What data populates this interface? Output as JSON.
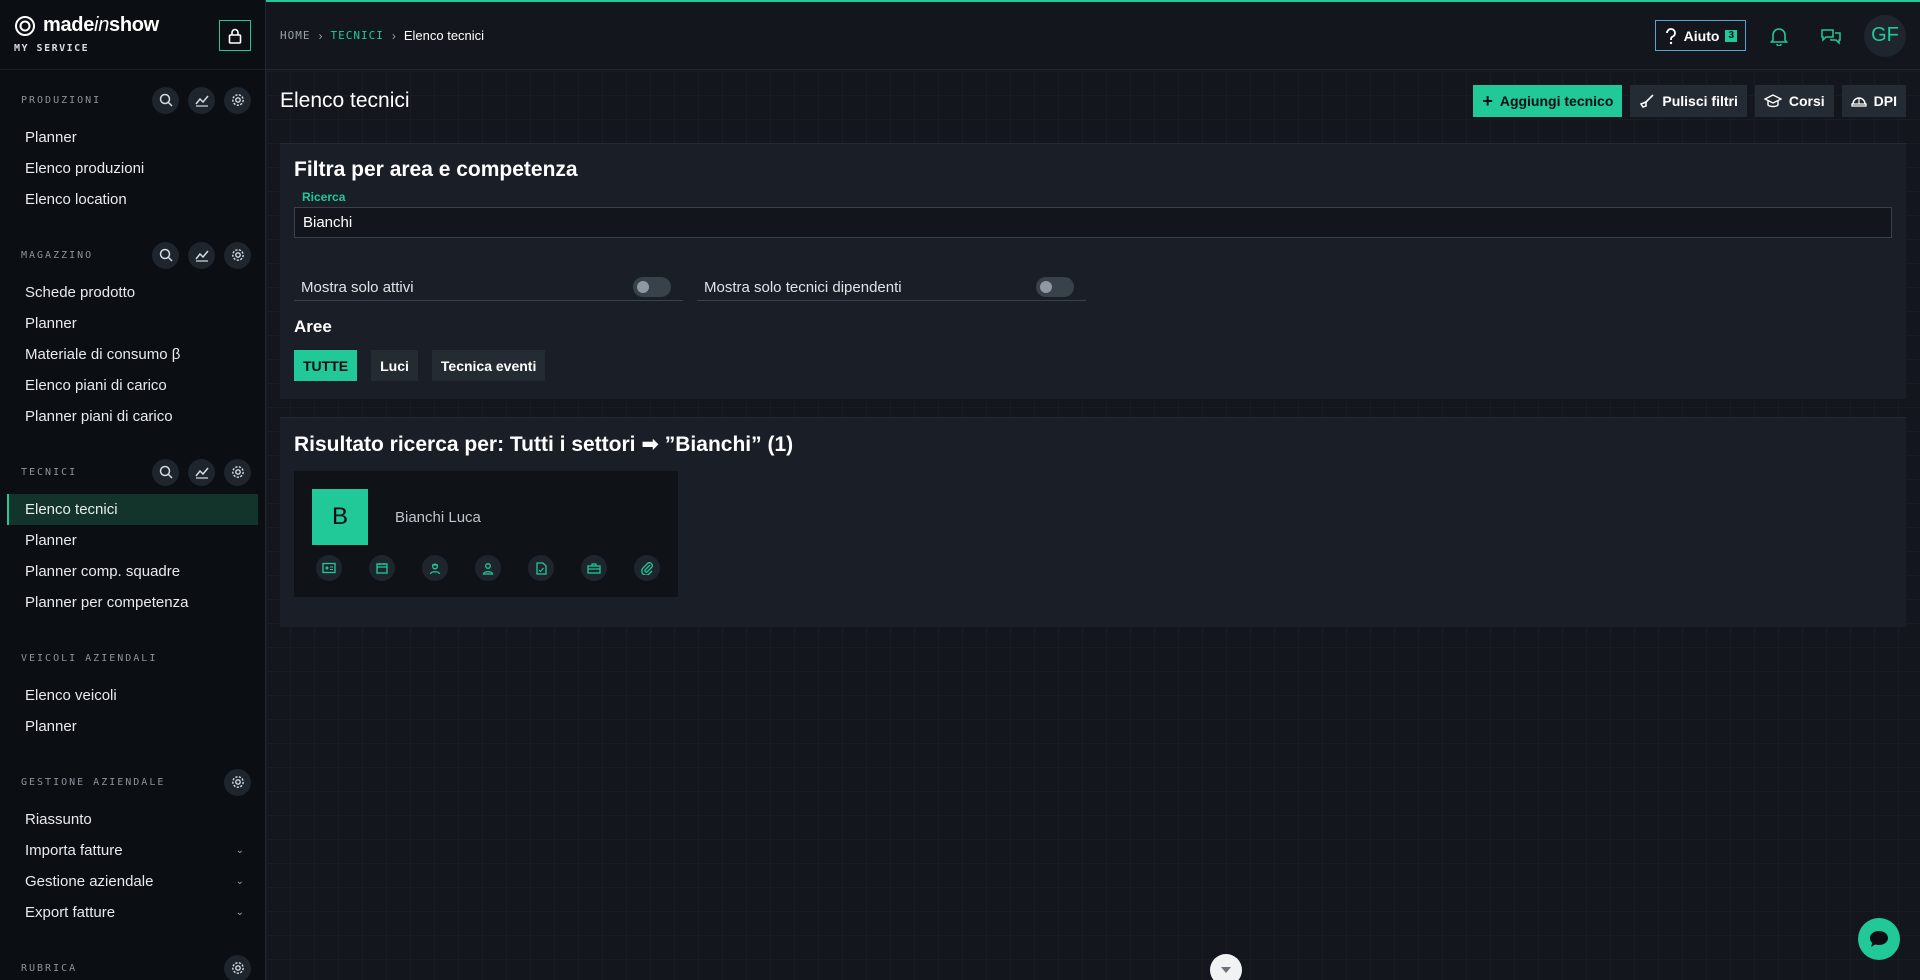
{
  "brand": {
    "logo_pre": "made",
    "logo_mid": "in",
    "logo_post": "show",
    "subtitle": "MY SERVICE"
  },
  "colors": {
    "accent": "#20c997",
    "background": "#13171d",
    "sidebar": "#0b0e12",
    "panel": "#1a1f27"
  },
  "sidebar": {
    "produzioni": {
      "title": "PRODUZIONI",
      "items": [
        "Planner",
        "Elenco produzioni",
        "Elenco location"
      ]
    },
    "magazzino": {
      "title": "MAGAZZINO",
      "items": [
        "Schede prodotto",
        "Planner",
        "Materiale di consumo β",
        "Elenco piani di carico",
        "Planner piani di carico"
      ]
    },
    "tecnici": {
      "title": "TECNICI",
      "items": [
        "Elenco tecnici",
        "Planner",
        "Planner comp. squadre",
        "Planner per competenza"
      ]
    },
    "veicoli": {
      "title": "VEICOLI AZIENDALI",
      "items": [
        "Elenco veicoli",
        "Planner"
      ]
    },
    "gestione": {
      "title": "GESTIONE AZIENDALE",
      "items": [
        "Riassunto",
        "Importa fatture",
        "Gestione aziendale",
        "Export fatture"
      ]
    },
    "rubrica": {
      "title": "RUBRICA"
    }
  },
  "breadcrumb": {
    "home": "HOME",
    "section": "TECNICI",
    "current": "Elenco tecnici"
  },
  "topbar": {
    "help_label": "Aiuto",
    "help_count": "3",
    "avatar_initials": "GF"
  },
  "page": {
    "title": "Elenco tecnici",
    "actions": {
      "add": "Aggiungi tecnico",
      "clear": "Pulisci filtri",
      "courses": "Corsi",
      "dpi": "DPI"
    }
  },
  "filter": {
    "title": "Filtra per area e competenza",
    "search_label": "Ricerca",
    "search_value": "Bianchi",
    "toggle_active": "Mostra solo attivi",
    "toggle_employees": "Mostra solo tecnici dipendenti",
    "areas_title": "Aree",
    "areas": [
      "TUTTE",
      "Luci",
      "Tecnica eventi"
    ],
    "active_area": "TUTTE"
  },
  "results": {
    "title": "Risultato ricerca per: Tutti i settori ➡ ”Bianchi” (1)",
    "items": [
      {
        "initial": "B",
        "name": "Bianchi Luca"
      }
    ]
  }
}
